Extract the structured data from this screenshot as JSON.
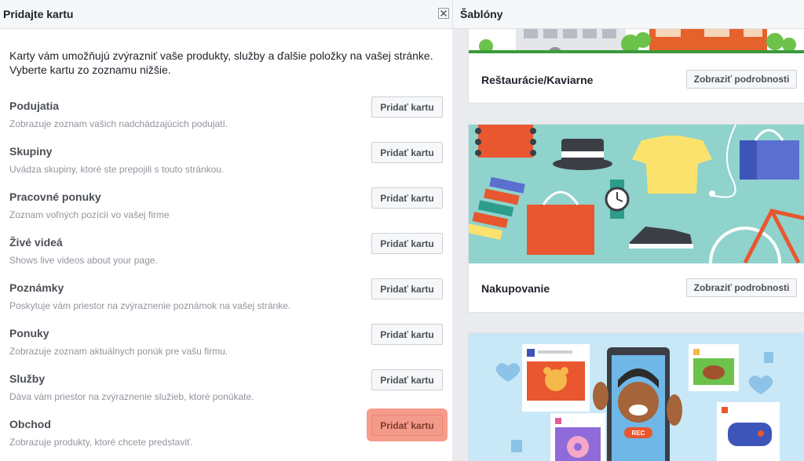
{
  "left_panel": {
    "title": "Pridajte kartu",
    "intro": "Karty vám umožňujú zvýrazniť vaše produkty, služby a ďalšie položky na vašej stránke. Vyberte kartu zo zoznamu nižšie.",
    "button_label": "Pridať kartu",
    "tabs": [
      {
        "name": "Podujatia",
        "desc": "Zobrazuje zoznam vašich nadchádzajúcich podujatí."
      },
      {
        "name": "Skupiny",
        "desc": "Uvádza skupiny, ktoré ste prepojili s touto stránkou."
      },
      {
        "name": "Pracovné ponuky",
        "desc": "Zoznam voľných pozícií vo vašej firme"
      },
      {
        "name": "Živé videá",
        "desc": "Shows live videos about your page."
      },
      {
        "name": "Poznámky",
        "desc": "Poskytuje vám priestor na zvýraznenie poznámok na vašej stránke."
      },
      {
        "name": "Ponuky",
        "desc": "Zobrazuje zoznam aktuálnych ponúk pre vašu firmu."
      },
      {
        "name": "Služby",
        "desc": "Dáva vám priestor na zvýraznenie služieb, ktoré ponúkate."
      },
      {
        "name": "Obchod",
        "desc": "Zobrazuje produkty, ktoré chcete predstaviť."
      }
    ],
    "highlighted_tab": "Obchod"
  },
  "right_panel": {
    "title": "Šablóny",
    "detail_label": "Zobraziť podrobnosti",
    "templates": [
      {
        "name": "Reštaurácie/Kaviarne"
      },
      {
        "name": "Nakupovanie"
      },
      {
        "name": ""
      }
    ],
    "rec_badge": "REC"
  },
  "colors": {
    "header_bg": "#f6f7f9",
    "panel_bg": "#e9ebee",
    "highlight": "#f79b8b",
    "shopping_bg": "#8fd3cc",
    "video_bg": "#c9e8f7"
  },
  "icons": [
    "close-icon"
  ]
}
